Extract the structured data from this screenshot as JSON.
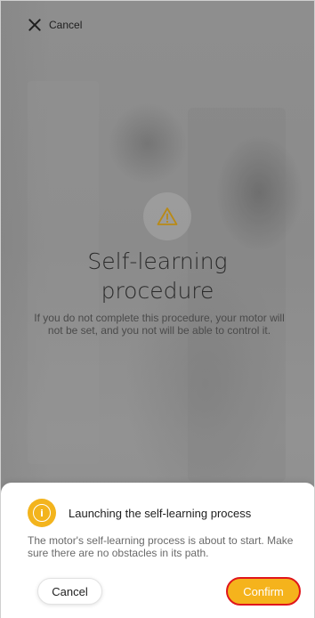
{
  "top_bar": {
    "cancel_label": "Cancel",
    "close_icon": "close-icon"
  },
  "main": {
    "warning_icon": "warning-triangle-icon",
    "title_line1": "Self-learning",
    "title_line2": "procedure",
    "description": "If you do not complete this procedure, your motor will not be set, and you not will be able to control it."
  },
  "sheet": {
    "info_icon": "info-icon",
    "info_glyph": "i",
    "title": "Launching the self-learning process",
    "text": "The motor's self-learning process is about to start. Make sure there are no obstacles in its path.",
    "cancel_label": "Cancel",
    "confirm_label": "Confirm"
  },
  "colors": {
    "accent": "#f5b31c",
    "highlight_border": "#e0161b",
    "overlay": "#8f8f8f"
  }
}
